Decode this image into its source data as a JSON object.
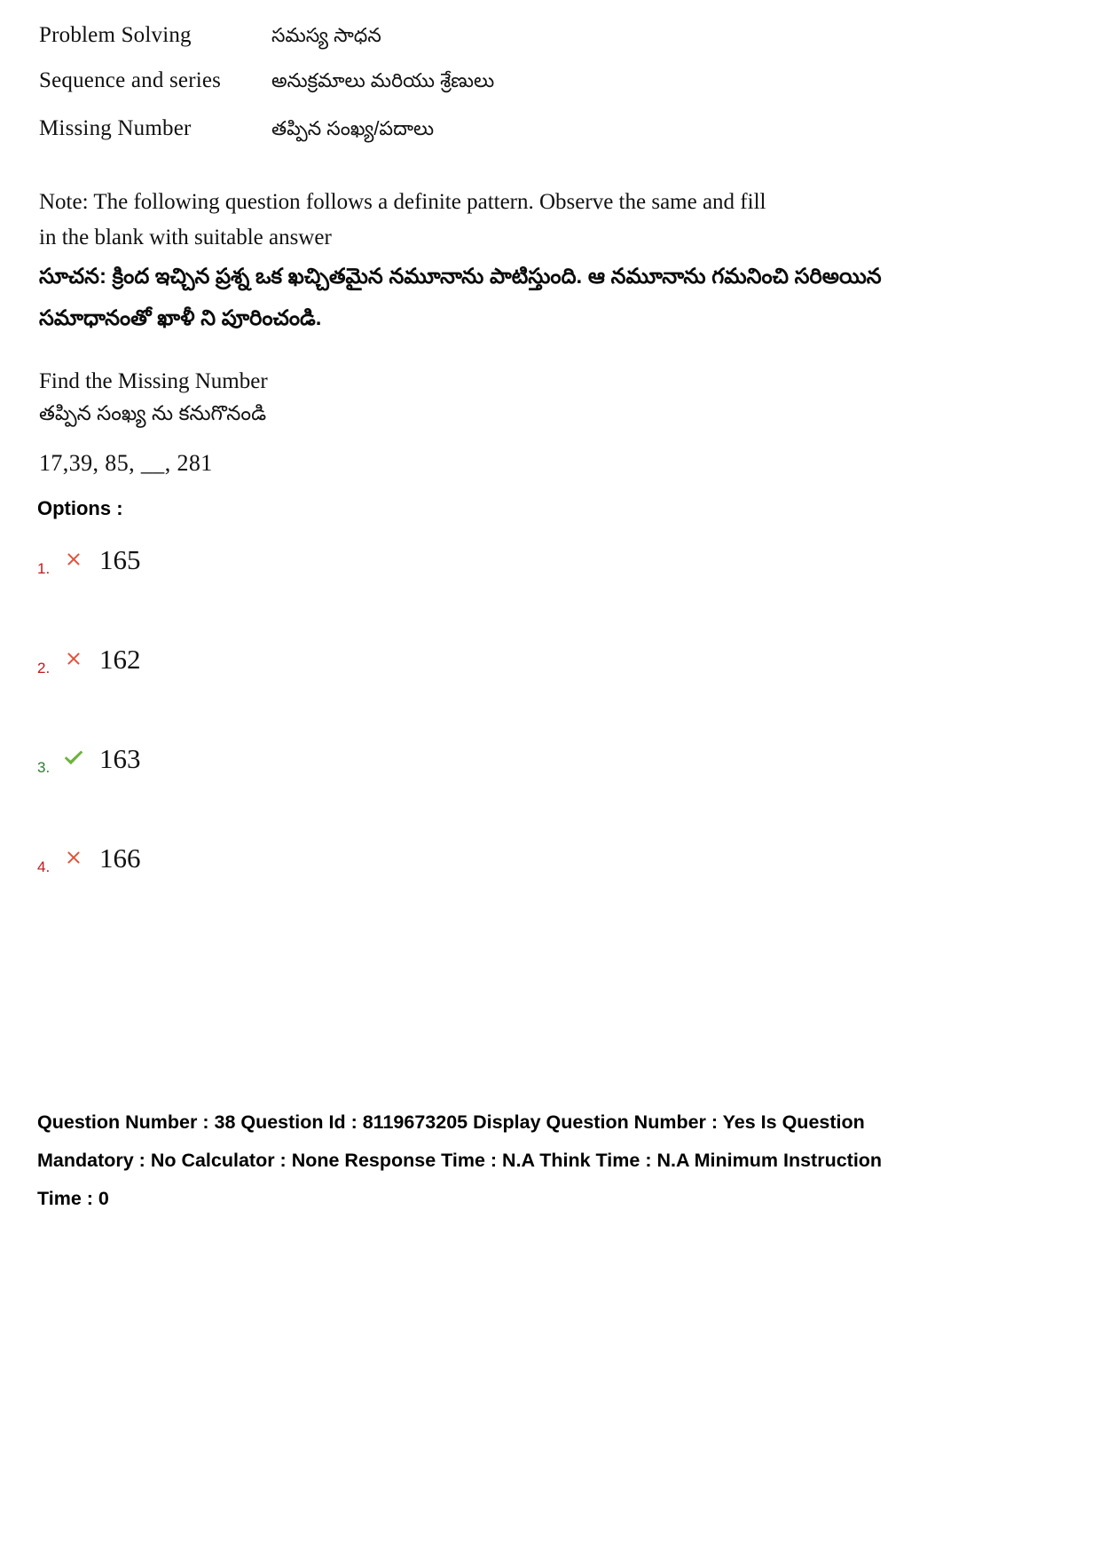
{
  "topics": [
    {
      "english": "Problem Solving",
      "telugu": "సమస్య సాధన"
    },
    {
      "english": "Sequence and series",
      "telugu": "అనుక్రమాలు మరియు శ్రేణులు"
    },
    {
      "english": "Missing Number",
      "telugu": "తప్పిన సంఖ్య/పదాలు"
    }
  ],
  "note": {
    "english": "Note:  The following question follows a definite pattern. Observe the same and fill in the blank with suitable answer",
    "telugu": "సూచన: క్రింద  ఇచ్చిన ప్రశ్న  ఒక ఖచ్చితమైన నమూనాను పాటిస్తుంది. ఆ నమూనాను గమనించి సరిఅయిన సమాధానంతో ఖాళీ ని పూరించండి."
  },
  "question": {
    "stem_english": "Find the Missing Number",
    "stem_telugu": "తప్పిన సంఖ్య  ను  కనుగొనండి",
    "sequence": "17,39, 85, __, 281"
  },
  "options_label": "Options :",
  "options": [
    {
      "number": "1.",
      "value": "165",
      "status": "wrong",
      "icon": "cross-icon"
    },
    {
      "number": "2.",
      "value": "162",
      "status": "wrong",
      "icon": "cross-icon"
    },
    {
      "number": "3.",
      "value": "163",
      "status": "correct",
      "icon": "check-icon"
    },
    {
      "number": "4.",
      "value": "166",
      "status": "wrong",
      "icon": "cross-icon"
    }
  ],
  "metadata": {
    "line1": "Question Number : 38 Question Id : 8119673205 Display Question Number : Yes Is Question",
    "line2": "Mandatory : No Calculator : None Response Time : N.A Think Time : N.A Minimum Instruction",
    "line3": "Time : 0"
  },
  "colors": {
    "wrong": "#e2513a",
    "correct": "#6cb33f",
    "number_wrong": "#c0191b",
    "number_correct": "#2e7d32"
  }
}
